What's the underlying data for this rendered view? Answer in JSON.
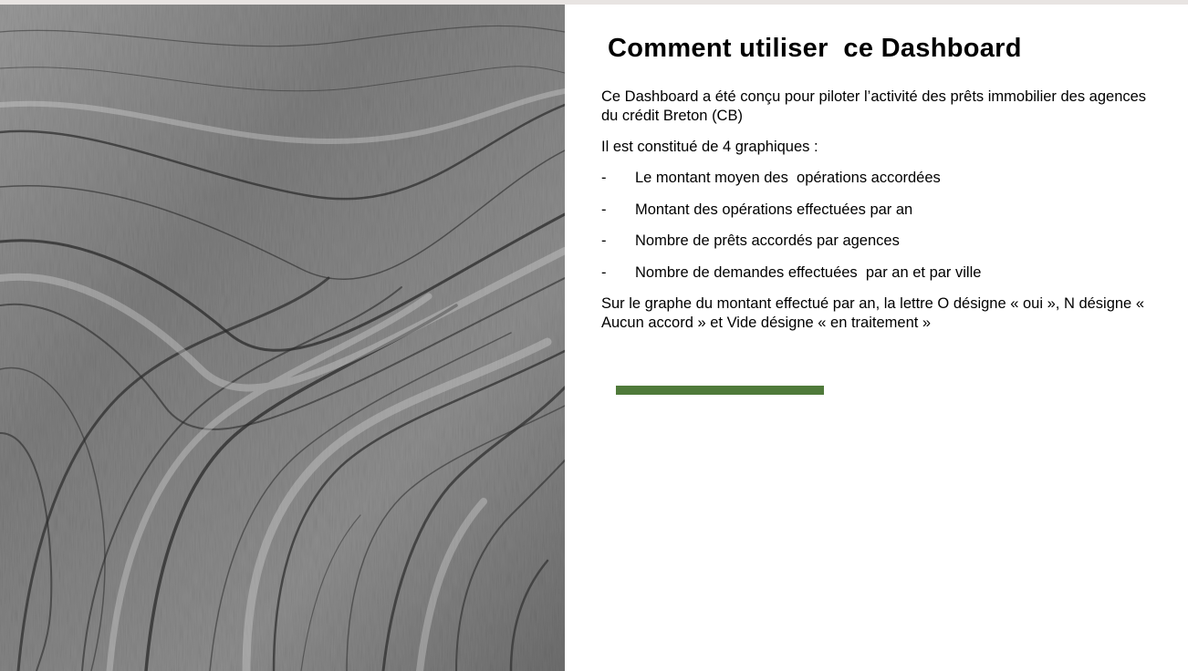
{
  "page": {
    "title": "Comment utiliser  ce Dashboard",
    "intro": "Ce Dashboard a été conçu pour piloter l’activité des prêts immobilier des agences du crédit Breton (CB)",
    "lead": "Il est constitué de 4 graphiques :",
    "bullets": [
      {
        "marker": "-",
        "text": "Le montant moyen des  opérations accordées"
      },
      {
        "marker": "-",
        "text": "Montant des opérations effectuées par an"
      },
      {
        "marker": "-",
        "text": "Nombre de prêts accordés par agences"
      },
      {
        "marker": "-",
        "text": "Nombre de demandes effectuées  par an et par ville"
      }
    ],
    "note": "Sur le graphe du montant effectué par an, la lettre O désigne « oui », N désigne « Aucun accord » et Vide désigne « en traitement »"
  },
  "colors": {
    "accent": "#4f7a3a",
    "text": "#000000",
    "background": "#ffffff"
  },
  "image": {
    "subject": "black-and-white wood grain texture"
  }
}
